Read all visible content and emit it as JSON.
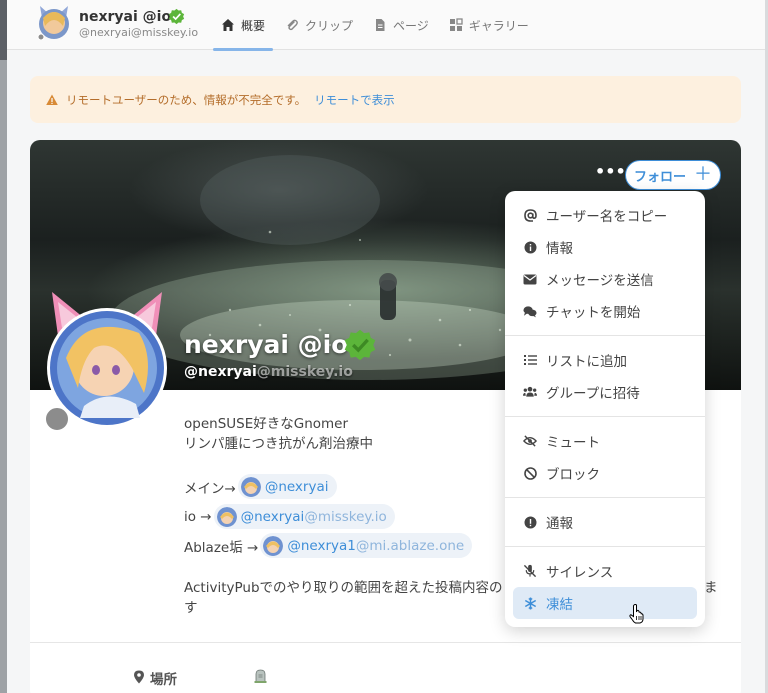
{
  "header": {
    "name": "nexryai @io",
    "handle": "@nexryai@misskey.io",
    "tabs": [
      {
        "label": "概要",
        "icon": "home-icon",
        "active": true
      },
      {
        "label": "クリップ",
        "icon": "paperclip-icon",
        "active": false
      },
      {
        "label": "ページ",
        "icon": "file-icon",
        "active": false
      },
      {
        "label": "ギャラリー",
        "icon": "gallery-icon",
        "active": false
      }
    ]
  },
  "notice": {
    "text": "リモートユーザーのため、情報が不完全です。",
    "link": "リモートで表示"
  },
  "profile": {
    "name": "nexryai @io",
    "username": "@nexryai",
    "host": "@misskey.io",
    "more_label": "•••",
    "follow_label": "フォロー",
    "follow_icon": "＋",
    "bio_line1": "openSUSE好きなGnomer",
    "bio_line2": "リンパ腫につき抗がん剤治療中",
    "links": [
      {
        "prefix": "メイン→",
        "user": "@nexryai",
        "host": ""
      },
      {
        "prefix": "io →",
        "user": "@nexryai",
        "host": "@misskey.io"
      },
      {
        "prefix": "Ablaze垢 →",
        "user": "@nexrya1",
        "host": "@mi.ablaze.one"
      }
    ],
    "bio_trailing": "ActivityPubでのやり取りの範囲を超えた投稿内容の",
    "bio_trailing_end": "ま",
    "bio_trailing_line2": "す",
    "field_label": "場所"
  },
  "menu": {
    "groups": [
      [
        {
          "label": "ユーザー名をコピー",
          "icon": "at-icon"
        },
        {
          "label": "情報",
          "icon": "info-icon"
        },
        {
          "label": "メッセージを送信",
          "icon": "envelope-icon"
        },
        {
          "label": "チャットを開始",
          "icon": "chat-icon"
        }
      ],
      [
        {
          "label": "リストに追加",
          "icon": "list-icon"
        },
        {
          "label": "グループに招待",
          "icon": "users-icon"
        }
      ],
      [
        {
          "label": "ミュート",
          "icon": "eye-slash-icon"
        },
        {
          "label": "ブロック",
          "icon": "ban-icon"
        }
      ],
      [
        {
          "label": "通報",
          "icon": "exclamation-icon"
        }
      ],
      [
        {
          "label": "サイレンス",
          "icon": "mic-slash-icon"
        },
        {
          "label": "凍結",
          "icon": "snowflake-icon",
          "hover": true
        }
      ]
    ]
  },
  "colors": {
    "accent": "#3e8ed8",
    "verified": "#5cb53a",
    "warning_bg": "#fdf0df",
    "warning_text": "#b46d2a",
    "menu_hover_bg": "#dfeaf6"
  }
}
